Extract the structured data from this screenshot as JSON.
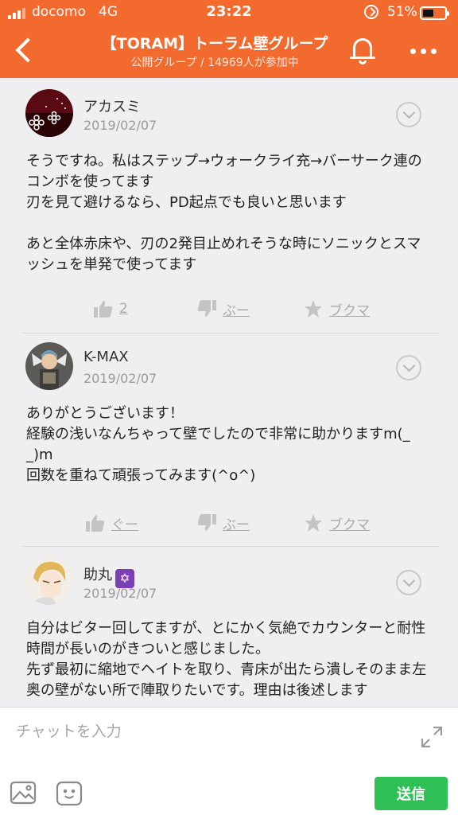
{
  "status_bar": {
    "carrier": "docomo",
    "network": "4G",
    "time": "23:22",
    "battery_percent": "51%",
    "battery_level": 0.51
  },
  "header": {
    "title": "【TORAM】トーラム壁グループ",
    "subtitle": "公開グループ / 14969人が参加中",
    "icons": [
      "back-arrow-icon",
      "bell-icon",
      "more-icon"
    ]
  },
  "posts": [
    {
      "author": "アカスミ",
      "date": "2019/02/07",
      "body": "そうですね。私はステップ→ウォークライ充→バーサーク連のコンボを使ってます\n刃を見て避けるなら、PD起点でも良いと思います\n\nあと全体赤床や、刃の2発目止めれそうな時にソニックとスマッシュを単発で使ってます",
      "like_label": "2",
      "dislike_label": "ぶー",
      "bookmark_label": "ブクマ"
    },
    {
      "author": "K-MAX",
      "date": "2019/02/07",
      "body": "ありがとうございます！\n経験の浅いなんちゃって壁でしたので非常に助かりますm(_ _)m\n回数を重ねて頑張ってみます(^o^)",
      "like_label": "ぐー",
      "dislike_label": "ぶー",
      "bookmark_label": "ブクマ"
    },
    {
      "author": "助丸",
      "badge": "✡",
      "date": "2019/02/07",
      "body": "自分はビター回してますが、とにかく気絶でカウンターと耐性時間が長いのがきついと感じました。\n先ず最初に縮地でヘイトを取り、青床が出たら潰しそのまま左奥の壁がない所で陣取りたいです。理由は後述します"
    }
  ],
  "input_bar": {
    "placeholder": "チャットを入力",
    "send_label": "送信"
  },
  "colors": {
    "header_bg": "#f26a2e",
    "send_button": "#2fbf55"
  }
}
